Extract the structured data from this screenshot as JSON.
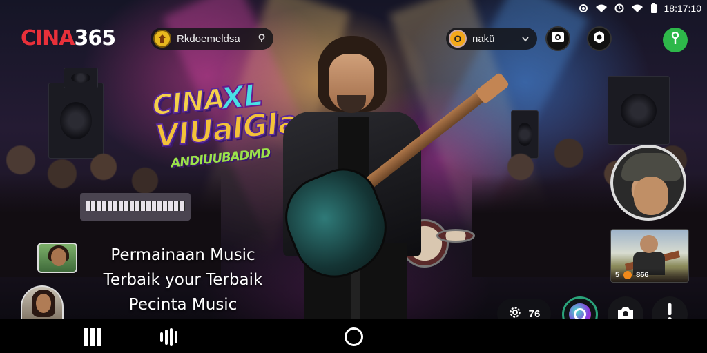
{
  "status_bar": {
    "time": "18:17:10",
    "icons": [
      "data-saver-icon",
      "wifi-icon",
      "alarm-icon",
      "wifi-icon",
      "battery-icon"
    ]
  },
  "app": {
    "logo_primary": "CINA",
    "logo_secondary": "365",
    "logo_primary_color": "#e8303a",
    "logo_secondary_color": "#ffffff"
  },
  "top_bar": {
    "location_label": "Rkdoemeldsa",
    "name_label": "nakü",
    "name_badge": "O"
  },
  "artwork_title": {
    "line1": "CINA",
    "line1_accent": "XL",
    "line2": "VIUaIGIa",
    "line3": "ANDIUUBADMD"
  },
  "caption": {
    "line1": "Permainaan Music",
    "line2": "Terbaik your Terbaik",
    "line3": "Pecinta Music"
  },
  "video_thumb": {
    "badge": "5",
    "count": "866"
  },
  "bottom_controls": {
    "settings_count": "76",
    "accent_color": "#2aa37a"
  }
}
